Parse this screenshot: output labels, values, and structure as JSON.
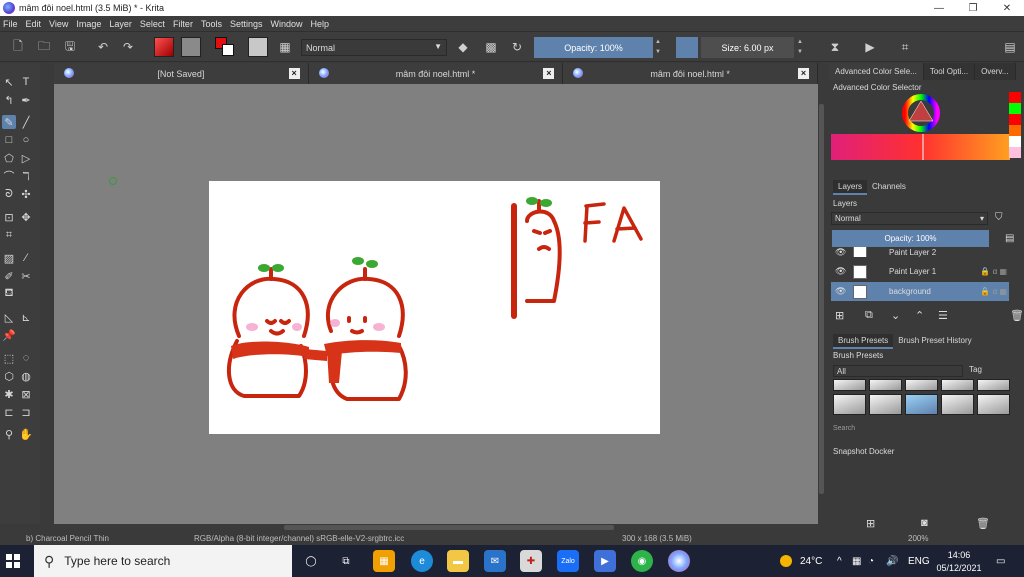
{
  "window": {
    "title": "mâm đôi noel.html (3.5 MiB)  * - Krita",
    "minimize": "—",
    "maximize": "❐",
    "close": "✕"
  },
  "menu": [
    "File",
    "Edit",
    "View",
    "Image",
    "Layer",
    "Select",
    "Filter",
    "Tools",
    "Settings",
    "Window",
    "Help"
  ],
  "toolbar": {
    "blend_mode": "Normal",
    "opacity": "Opacity: 100%",
    "size": "Size: 6.00 px",
    "colors": {
      "foreground": "#e01010",
      "background": "#ffffff",
      "accent": "#5f82ad"
    }
  },
  "tabs": [
    {
      "label": "[Not Saved]"
    },
    {
      "label": "mâm đôi noel.html *"
    },
    {
      "label": "mâm đôi noel.html *"
    }
  ],
  "drawing": {
    "text": "FA",
    "ink_color": "#c8250f",
    "leaf_color": "#3aa832",
    "blush_color": "#f4a0c8"
  },
  "statusbar": {
    "brush": "b) Charcoal Pencil Thin",
    "color_space": "RGB/Alpha (8-bit integer/channel)  sRGB-elle-V2-srgbtrc.icc",
    "image_size": "300 x 168 (3.5 MiB)",
    "zoom": "200%"
  },
  "dock": {
    "tabs": [
      "Advanced Color Sele...",
      "Tool Opti...",
      "Overv..."
    ],
    "color_selector_title": "Advanced Color Selector",
    "layers_tabs": [
      "Layers",
      "Channels"
    ],
    "layers_title": "Layers",
    "layer_blend": "Normal",
    "layer_opacity": "Opacity:  100%",
    "layers": [
      {
        "name": "Paint Layer 2",
        "selected": false
      },
      {
        "name": "Paint Layer 1",
        "selected": false
      },
      {
        "name": "background",
        "selected": true
      }
    ],
    "brush_tabs": [
      "Brush Presets",
      "Brush Preset History"
    ],
    "brush_title": "Brush Presets",
    "brush_filter": "All",
    "brush_tag": "Tag",
    "brush_search_placeholder": "Search",
    "snapshot_title": "Snapshot Docker"
  },
  "taskbar": {
    "search_placeholder": "Type here to search",
    "weather": "24°C",
    "language": "ENG",
    "time": "14:06",
    "date": "05/12/2021",
    "zalo_label": "Zalo"
  }
}
